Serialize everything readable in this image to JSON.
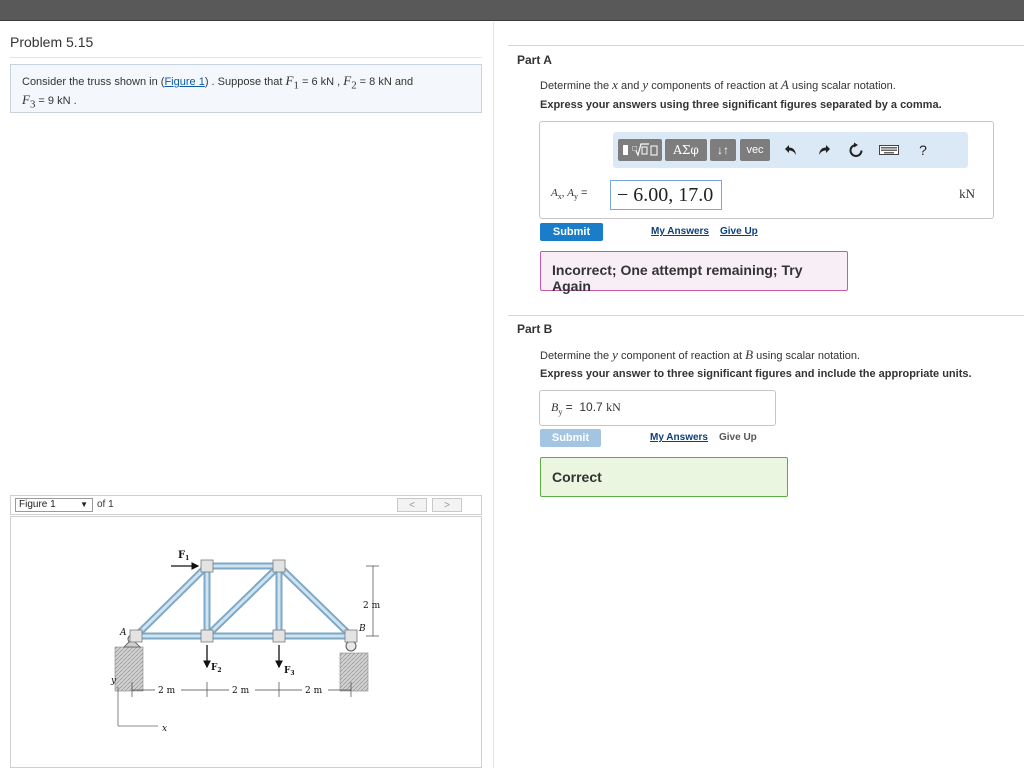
{
  "problem": {
    "title": "Problem 5.15",
    "text_pre": "Consider the truss shown in (",
    "figure_link": "Figure 1",
    "text_mid": ") . Suppose that ",
    "f1": "F",
    "f1_sub": "1",
    "f1_val": " = 6  kN , ",
    "f2": "F",
    "f2_sub": "2",
    "f2_val": " = 8  kN and",
    "f3": "F",
    "f3_sub": "3",
    "f3_val": " = 9  kN ."
  },
  "part_a": {
    "label": "Part A",
    "instruction_pre": "Determine the ",
    "instruction_x": "x",
    "instruction_and": " and ",
    "instruction_y": "y",
    "instruction_mid": " components of reaction at ",
    "instruction_point": "A",
    "instruction_post": " using scalar notation.",
    "bold_instruction": "Express your answers using three significant figures separated by a comma.",
    "toolbar": {
      "greek": "ΑΣφ",
      "arrows": "↓↑",
      "vec": "vec",
      "help": "?"
    },
    "answer_label": "Ax, Ay =",
    "answer_value": "− 6.00, 17.0",
    "unit": "kN",
    "submit": "Submit",
    "my_answers": "My Answers",
    "give_up": "Give Up",
    "feedback": "Incorrect; One attempt remaining; Try Again"
  },
  "part_b": {
    "label": "Part B",
    "instruction_pre": "Determine the ",
    "instruction_y": "y",
    "instruction_mid": " component of reaction at ",
    "instruction_point": "B",
    "instruction_post": " using scalar notation.",
    "bold_instruction": "Express your answer to three significant figures and include the appropriate units.",
    "answer_label": "By =",
    "answer_value": "10.7",
    "answer_unit": "kN",
    "submit": "Submit",
    "my_answers": "My Answers",
    "give_up": "Give Up",
    "feedback": "Correct"
  },
  "figure": {
    "selector": "Figure 1",
    "of": "of 1",
    "prev": "<",
    "next": ">",
    "labels": {
      "f1": "F",
      "f1_sub": "1",
      "f2": "F",
      "f2_sub": "2",
      "f3": "F",
      "f3_sub": "3",
      "a": "A",
      "b": "B",
      "height": "2 m",
      "span1": "2 m",
      "span2": "2 m",
      "span3": "2 m",
      "x": "x",
      "y": "y"
    }
  },
  "colors": {
    "submit_active": "#1a7dc9",
    "submit_disabled": "#a3c5e2",
    "incorrect_border": "#c45bb0",
    "correct_border": "#5cac45",
    "member": "#b9d6ea"
  }
}
